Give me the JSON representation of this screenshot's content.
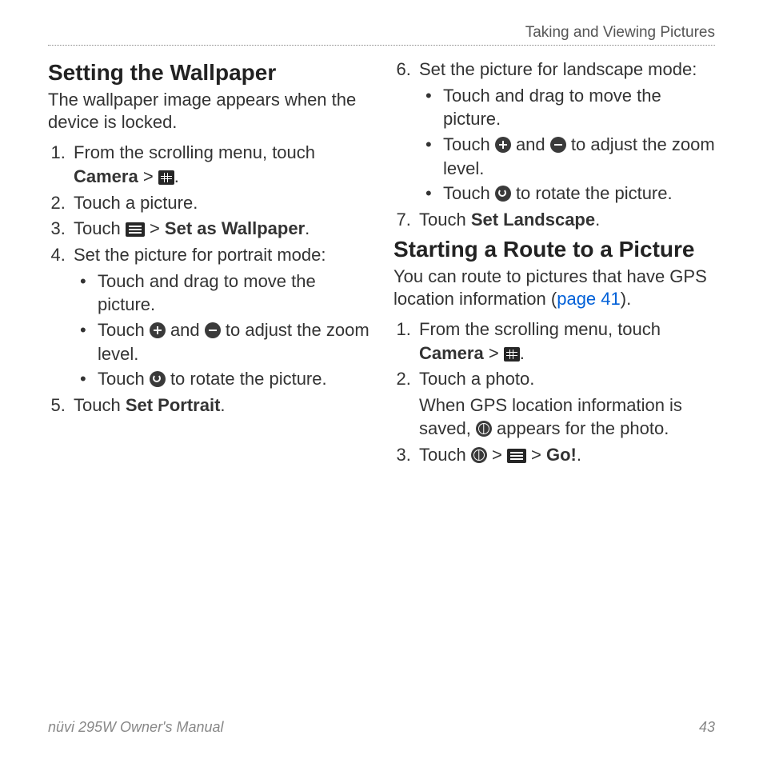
{
  "header": {
    "running_title": "Taking and Viewing Pictures"
  },
  "footer": {
    "manual": "nüvi 295W Owner's Manual",
    "page": "43"
  },
  "sec1": {
    "title": "Setting the Wallpaper",
    "intro": "The wallpaper image appears when the device is locked.",
    "step1_a": "From the scrolling menu, touch ",
    "step1_b": "Camera",
    "step1_c": " > ",
    "step1_d": ".",
    "step2": "Touch a picture.",
    "step3_a": "Touch ",
    "step3_b": " > ",
    "step3_c": "Set as Wallpaper",
    "step3_d": ".",
    "step4": "Set the picture for portrait mode:",
    "s4a": "Touch and drag to move the picture.",
    "s4b_a": "Touch ",
    "s4b_b": " and ",
    "s4b_c": " to adjust the zoom level.",
    "s4c_a": "Touch ",
    "s4c_b": " to rotate the picture.",
    "step5_a": "Touch ",
    "step5_b": "Set Portrait",
    "step5_c": ".",
    "step6": "Set the picture for landscape mode:",
    "s6a": "Touch and drag to move the picture.",
    "s6b_a": "Touch ",
    "s6b_b": " and ",
    "s6b_c": " to adjust the zoom level.",
    "s6c_a": "Touch ",
    "s6c_b": " to rotate the picture.",
    "step7_a": "Touch ",
    "step7_b": "Set Landscape",
    "step7_c": "."
  },
  "sec2": {
    "title": "Starting a Route to a Picture",
    "intro_a": "You can route to pictures that have GPS location information (",
    "intro_link": "page 41",
    "intro_b": ").",
    "step1_a": "From the scrolling menu, touch ",
    "step1_b": "Camera",
    "step1_c": " > ",
    "step1_d": ".",
    "step2": "Touch a photo.",
    "note_a": "When GPS location information is saved, ",
    "note_b": " appears for the photo.",
    "step3_a": "Touch ",
    "step3_b": " > ",
    "step3_c": " > ",
    "step3_d": "Go!",
    "step3_e": "."
  }
}
